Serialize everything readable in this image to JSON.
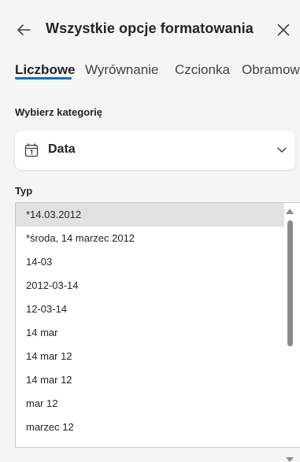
{
  "header": {
    "title": "Wszystkie opcje formatowania"
  },
  "tabs": [
    {
      "label": "Liczbowe",
      "active": true
    },
    {
      "label": "Wyrównanie",
      "active": false
    },
    {
      "label": "Czcionka",
      "active": false
    },
    {
      "label": "Obramowanie",
      "active": false
    }
  ],
  "category": {
    "label": "Wybierz kategorię",
    "selected": "Data",
    "icon": "calendar-icon"
  },
  "type_list": {
    "label": "Typ",
    "items": [
      "*14.03.2012",
      "*środa, 14 marzec 2012",
      "14-03",
      "2012-03-14",
      "12-03-14",
      "14 mar",
      "14 mar 12",
      "14 mar 12",
      "mar 12",
      "marzec 12"
    ],
    "selected_index": 0
  },
  "colors": {
    "accent": "#0f6cbd",
    "background": "#f5f5f5",
    "selected_row": "#e1e1e1"
  }
}
